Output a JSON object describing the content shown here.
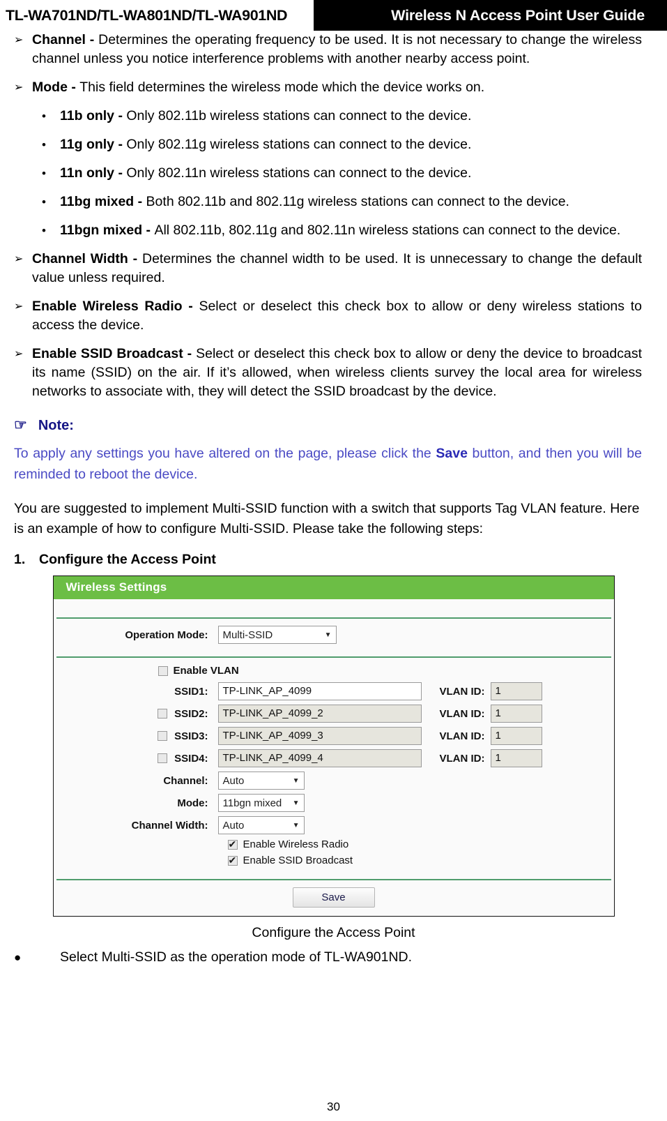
{
  "header": {
    "models": "TL-WA701ND/TL-WA801ND/TL-WA901ND",
    "guide_title": "Wireless N Access Point User Guide"
  },
  "bullets": [
    {
      "marker": "➢",
      "label": "Channel - ",
      "text": "Determines the operating frequency to be used. It is not necessary to change the wireless channel unless you notice interference problems with another nearby access point."
    },
    {
      "marker": "➢",
      "label": "Mode - ",
      "text": "This field determines the wireless mode which the device works on."
    }
  ],
  "mode_options": [
    {
      "marker": "•",
      "label": "11b only - ",
      "text": "Only 802.11b wireless stations can connect to the device."
    },
    {
      "marker": "•",
      "label": "11g only - ",
      "text": "Only 802.11g wireless stations can connect to the device."
    },
    {
      "marker": "•",
      "label": "11n only - ",
      "text": "Only 802.11n wireless stations can connect to the device."
    },
    {
      "marker": "•",
      "label": "11bg mixed - ",
      "text": "Both 802.11b and 802.11g wireless stations can connect to the device."
    },
    {
      "marker": "•",
      "label": "11bgn mixed - ",
      "text": "All 802.11b, 802.11g and 802.11n wireless stations can connect to the device."
    }
  ],
  "bullets2": [
    {
      "marker": "➢",
      "label": "Channel Width - ",
      "text": "Determines the channel width to be used. It is unnecessary to change the default value unless required."
    },
    {
      "marker": "➢",
      "label": "Enable Wireless Radio - ",
      "text": "Select or deselect this check box to allow or deny wireless stations to access the device."
    },
    {
      "marker": "➢",
      "label": "Enable SSID Broadcast - ",
      "text": "Select or deselect this check box to allow or deny the device to broadcast its name (SSID) on the air. If it’s allowed, when wireless clients survey the local area for wireless networks to associate with, they will detect the SSID broadcast by the device."
    }
  ],
  "note": {
    "icon": "☞",
    "heading": "Note:",
    "text_before": "To apply any settings you have altered on the page, please click the ",
    "bold_word": "Save",
    "text_after": " button, and then you will be reminded to reboot the device."
  },
  "paragraph": "You are suggested to implement Multi-SSID function with a switch that supports Tag VLAN feature. Here is an example of how to configure Multi-SSID. Please take the following steps:",
  "step": {
    "number": "1.",
    "title": "Configure the Access Point"
  },
  "panel": {
    "title": "Wireless Settings",
    "operation_mode_label": "Operation Mode:",
    "operation_mode_value": "Multi-SSID",
    "enable_vlan_label": "Enable VLAN",
    "enable_vlan_checked": false,
    "ssids": [
      {
        "label": "SSID1:",
        "value": "TP-LINK_AP_4099",
        "vlan_label": "VLAN ID:",
        "vlan_value": "1",
        "has_checkbox": false,
        "checked": false,
        "enabled": true
      },
      {
        "label": "SSID2:",
        "value": "TP-LINK_AP_4099_2",
        "vlan_label": "VLAN ID:",
        "vlan_value": "1",
        "has_checkbox": true,
        "checked": false,
        "enabled": false
      },
      {
        "label": "SSID3:",
        "value": "TP-LINK_AP_4099_3",
        "vlan_label": "VLAN ID:",
        "vlan_value": "1",
        "has_checkbox": true,
        "checked": false,
        "enabled": false
      },
      {
        "label": "SSID4:",
        "value": "TP-LINK_AP_4099_4",
        "vlan_label": "VLAN ID:",
        "vlan_value": "1",
        "has_checkbox": true,
        "checked": false,
        "enabled": false
      }
    ],
    "channel_label": "Channel:",
    "channel_value": "Auto",
    "mode_label": "Mode:",
    "mode_value": "11bgn mixed",
    "channel_width_label": "Channel Width:",
    "channel_width_value": "Auto",
    "enable_wireless_radio_label": "Enable Wireless Radio",
    "enable_wireless_radio_checked": true,
    "enable_ssid_broadcast_label": "Enable SSID Broadcast",
    "enable_ssid_broadcast_checked": true,
    "save_label": "Save",
    "caret": "▼",
    "header_color": "#6cbe45"
  },
  "figure_caption": "Configure the Access Point",
  "final_bullet": {
    "marker": "●",
    "text": "Select Multi-SSID as the operation mode of TL-WA901ND."
  },
  "page_number": "30"
}
